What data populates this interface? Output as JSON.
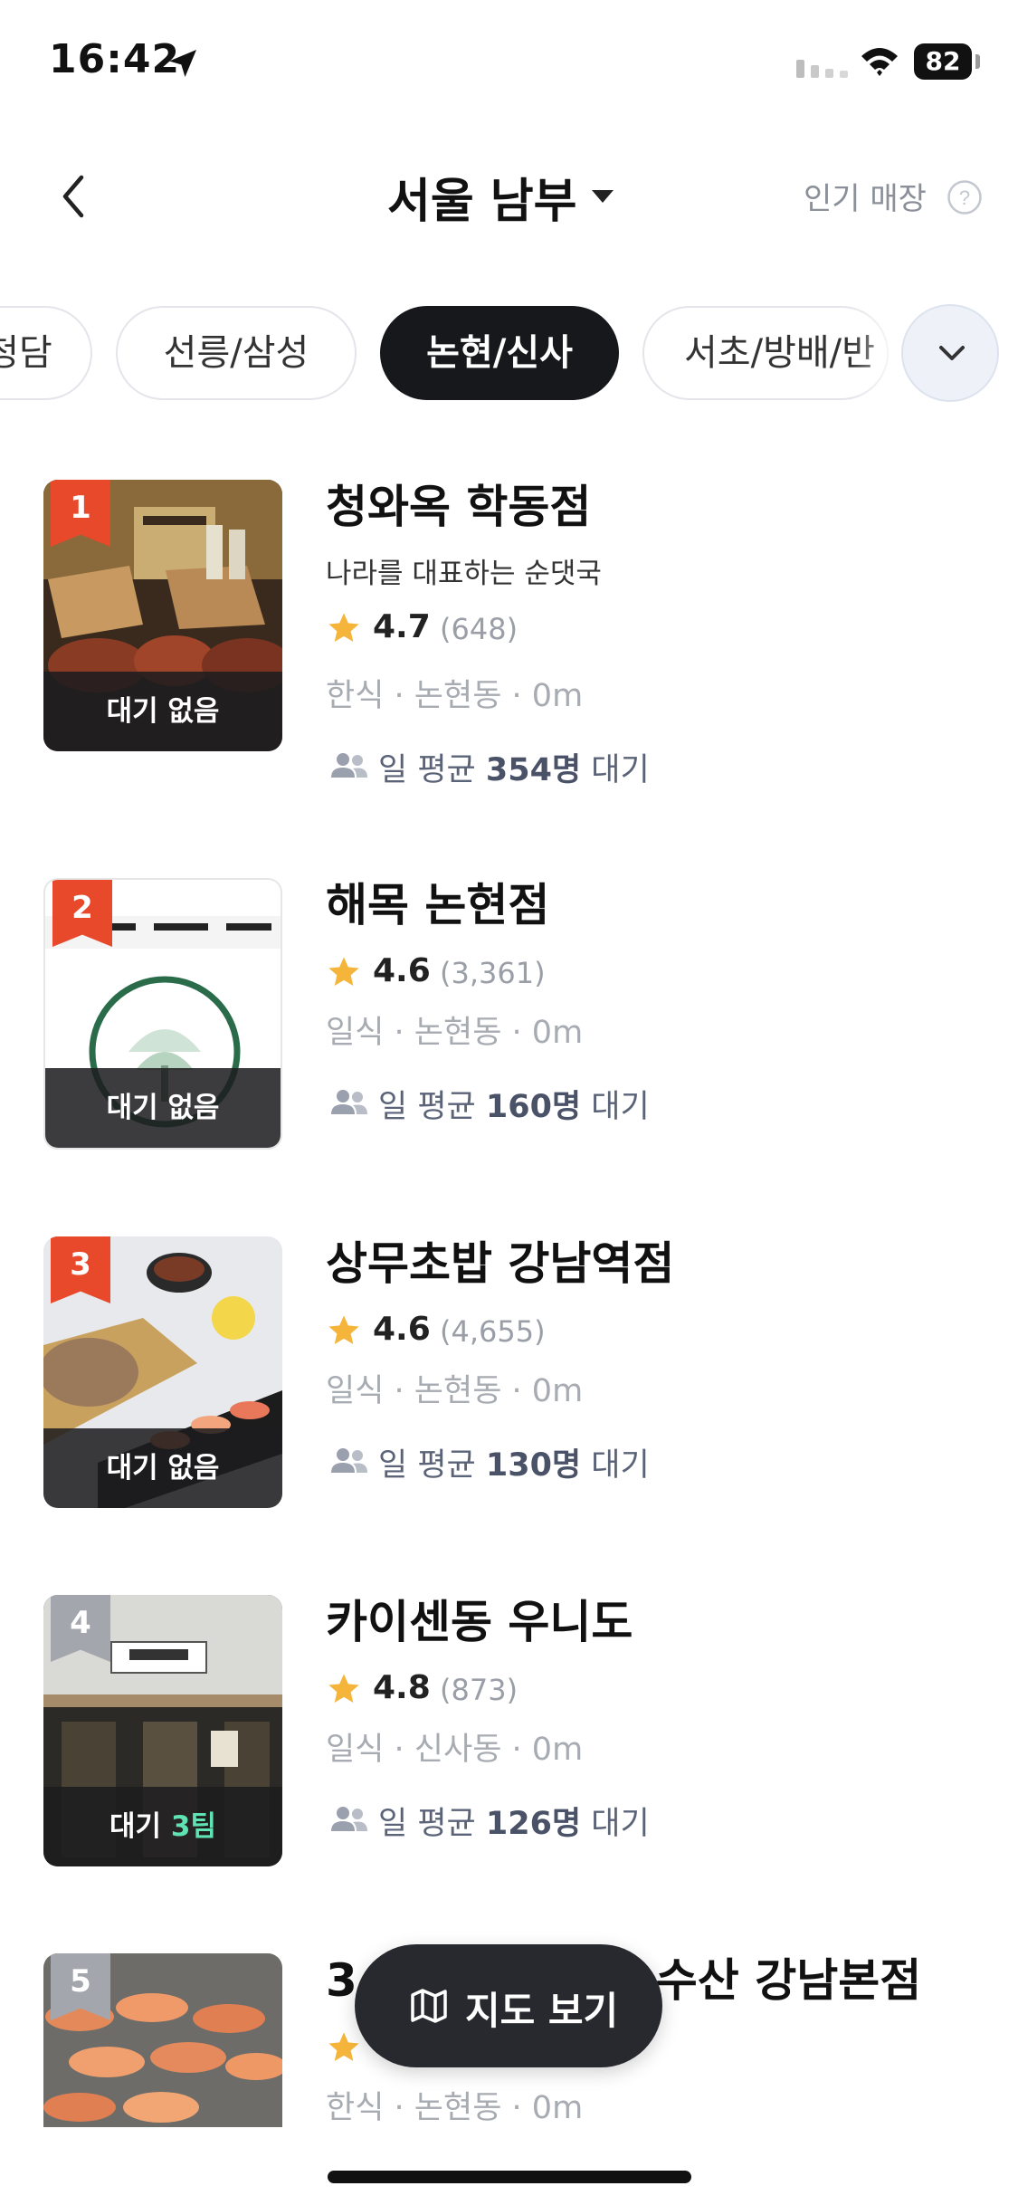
{
  "status_bar": {
    "time": "16:42",
    "battery": "82"
  },
  "header": {
    "title": "서울 남부",
    "popular_label": "인기 매장"
  },
  "chips": [
    "청담",
    "선릉/삼성",
    "논현/신사",
    "서초/방배/반"
  ],
  "active_chip": "논현/신사",
  "restaurants": [
    {
      "rank": "1",
      "name": "청와옥 학동점",
      "description": "나라를 대표하는 순댓국",
      "rating": "4.7",
      "reviews": "(648)",
      "category": "한식",
      "area": "논현동",
      "distance": "0m",
      "wait_status": "대기 없음",
      "avg_wait_prefix": "일 평균 ",
      "avg_wait_count": "354명",
      "avg_wait_suffix": " 대기"
    },
    {
      "rank": "2",
      "name": "해목 논현점",
      "description": "",
      "rating": "4.6",
      "reviews": "(3,361)",
      "category": "일식",
      "area": "논현동",
      "distance": "0m",
      "wait_status": "대기 없음",
      "avg_wait_prefix": "일 평균 ",
      "avg_wait_count": "160명",
      "avg_wait_suffix": " 대기"
    },
    {
      "rank": "3",
      "name": "상무초밥 강남역점",
      "description": "",
      "rating": "4.6",
      "reviews": "(4,655)",
      "category": "일식",
      "area": "논현동",
      "distance": "0m",
      "wait_status": "대기 없음",
      "avg_wait_prefix": "일 평균 ",
      "avg_wait_count": "130명",
      "avg_wait_suffix": " 대기"
    },
    {
      "rank": "4",
      "name": "카이센동 우니도",
      "description": "",
      "rating": "4.8",
      "reviews": "(873)",
      "category": "일식",
      "area": "신사동",
      "distance": "0m",
      "wait_prefix": "대기 ",
      "wait_teams": "3팀",
      "avg_wait_prefix": "일 평균 ",
      "avg_wait_count": "126명",
      "avg_wait_suffix": " 대기"
    },
    {
      "rank": "5",
      "name": "3",
      "name_tail": "수산 강남본점",
      "category": "한식",
      "area": "논현동",
      "distance": "0m"
    }
  ],
  "meta_separator": " · ",
  "map_button": {
    "label": "지도 보기"
  },
  "colors": {
    "accent_red": "#e8492a",
    "dark": "#17181c",
    "wait_highlight": "#5fe3b3",
    "star": "#f5b53a"
  }
}
